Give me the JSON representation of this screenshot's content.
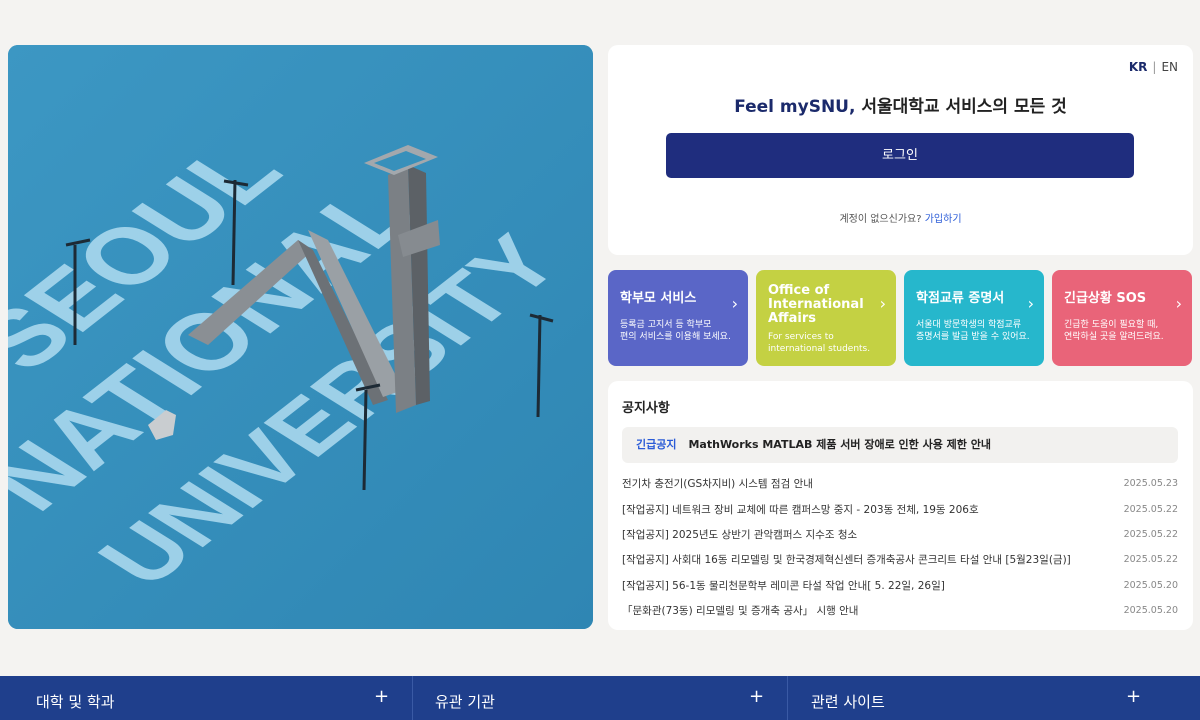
{
  "hero": {
    "art_words": [
      "SEOUL",
      "NATIONAL",
      "UNIVERSITY"
    ]
  },
  "lang": {
    "kr": "KR",
    "en": "EN"
  },
  "login": {
    "brand": "Feel mySNU,",
    "title_rest": " 서울대학교 서비스의 모든 것",
    "button_label": "로그인",
    "signup_question": "계정이 없으신가요?",
    "signup_link": "가입하기"
  },
  "tiles": [
    {
      "title": "학부모 서비스",
      "desc": "등록금 고지서 등 학부모\n편의 서비스를 이용해 보세요.",
      "color": "#5a66c7"
    },
    {
      "title": "Office of\nInternational\nAffairs",
      "desc": "For services to\ninternational students.",
      "color": "#c4d143"
    },
    {
      "title": "학점교류 증명서",
      "desc": "서울대 방문학생의 학점교류\n증명서를 발급 받을 수 있어요.",
      "color": "#26b7cc"
    },
    {
      "title": "긴급상황 SOS",
      "desc": "긴급한 도움이 필요할 때,\n연락하실 곳을 알려드려요.",
      "color": "#e96479"
    }
  ],
  "notice": {
    "title": "공지사항",
    "urgent_tag": "긴급공지",
    "urgent_text": "MathWorks MATLAB 제품 서버 장애로 인한 사용 제한 안내",
    "items": [
      {
        "text": "전기차 충전기(GS차지비) 시스템 점검 안내",
        "date": "2025.05.23"
      },
      {
        "text": "[작업공지] 네트워크 장비 교체에 따른 캠퍼스망 중지 - 203동 전체, 19동 206호",
        "date": "2025.05.22"
      },
      {
        "text": "[작업공지] 2025년도 상반기 관악캠퍼스 지수조 청소",
        "date": "2025.05.22"
      },
      {
        "text": "[작업공지] 사회대 16동 리모델링 및 한국경제혁신센터 증개축공사 콘크리트 타설 안내 [5월23일(금)]",
        "date": "2025.05.22"
      },
      {
        "text": "[작업공지] 56-1동 물리천문학부 레미콘 타설 작업 안내[ 5. 22일, 26일]",
        "date": "2025.05.20"
      },
      {
        "text": "「문화관(73동) 리모델링 및 증개축 공사」 시행 안내",
        "date": "2025.05.20"
      }
    ]
  },
  "footer": [
    {
      "label": "대학 및 학과",
      "icon": "plus-icon"
    },
    {
      "label": "유관 기관",
      "icon": "plus-icon"
    },
    {
      "label": "관련 사이트",
      "icon": "plus-icon"
    }
  ]
}
